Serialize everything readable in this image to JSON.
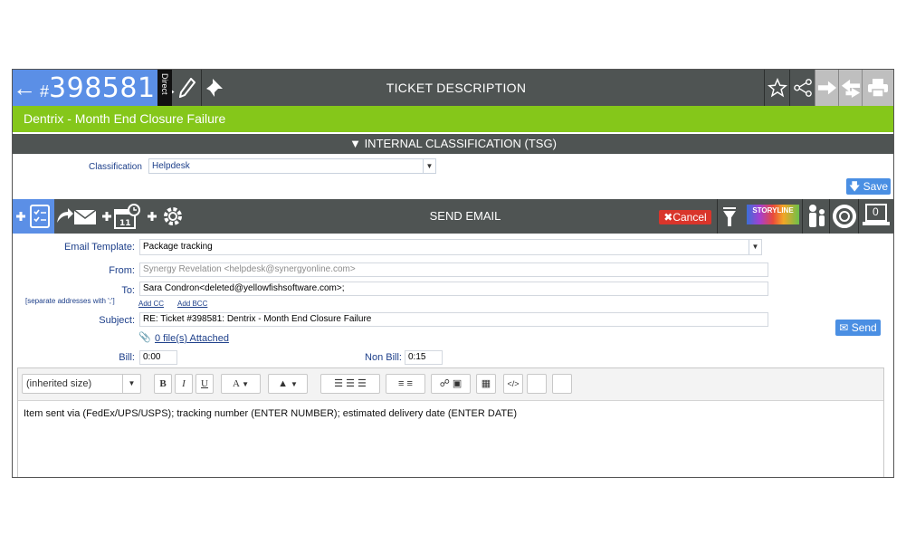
{
  "header": {
    "ticket_prefix": "#",
    "ticket_number": "398581",
    "direct_label": "Direct",
    "title": "TICKET DESCRIPTION",
    "icons": [
      "arrow-left-icon",
      "arrow-right-icon",
      "pencil-icon",
      "pin-icon",
      "star-icon",
      "share-icon",
      "forward-icon",
      "reply-all-icon",
      "print-icon"
    ]
  },
  "ticket_subject": "Dentrix - Month End Closure Failure",
  "classification_section": {
    "title": "INTERNAL CLASSIFICATION (TSG)",
    "label": "Classification",
    "value": "Helpdesk",
    "save_label": "Save"
  },
  "email_toolbar": {
    "title": "SEND EMAIL",
    "cancel_label": "Cancel",
    "storyline_label": "STORYLINE",
    "counter": "0",
    "icons": [
      "add-task-icon",
      "forward-email-icon",
      "add-schedule-icon",
      "add-settings-icon",
      "filter-icon",
      "people-icon",
      "lifebuoy-icon",
      "laptop-icon"
    ]
  },
  "email_form": {
    "template_label": "Email Template:",
    "template_value": "Package tracking",
    "from_label": "From:",
    "from_value": "Synergy Revelation <helpdesk@synergyonline.com>",
    "to_label": "To:",
    "to_hint": "[separate addresses with ';']",
    "to_value": "Sara Condron<deleted@yellowfishsoftware.com>;",
    "add_cc": "Add CC",
    "add_bcc": "Add BCC",
    "subject_label": "Subject:",
    "subject_value": "RE: Ticket #398581: Dentrix - Month End Closure Failure",
    "attachments_label": "0 file(s) Attached",
    "send_label": "Send",
    "bill_label": "Bill:",
    "bill_value": "0:00",
    "nonbill_label": "Non Bill:",
    "nonbill_value": "0:15"
  },
  "editor": {
    "font_size": "(inherited size)",
    "body_text": "Item sent via (FedEx/UPS/USPS); tracking number (ENTER NUMBER); estimated delivery date (ENTER DATE)"
  },
  "colors": {
    "header_bg": "#4f5453",
    "ticket_blue": "#5b8fe6",
    "subject_green": "#85c71a",
    "button_blue": "#4a8fe3",
    "cancel_red": "#d9352b",
    "label_blue": "#1d3f8a"
  }
}
